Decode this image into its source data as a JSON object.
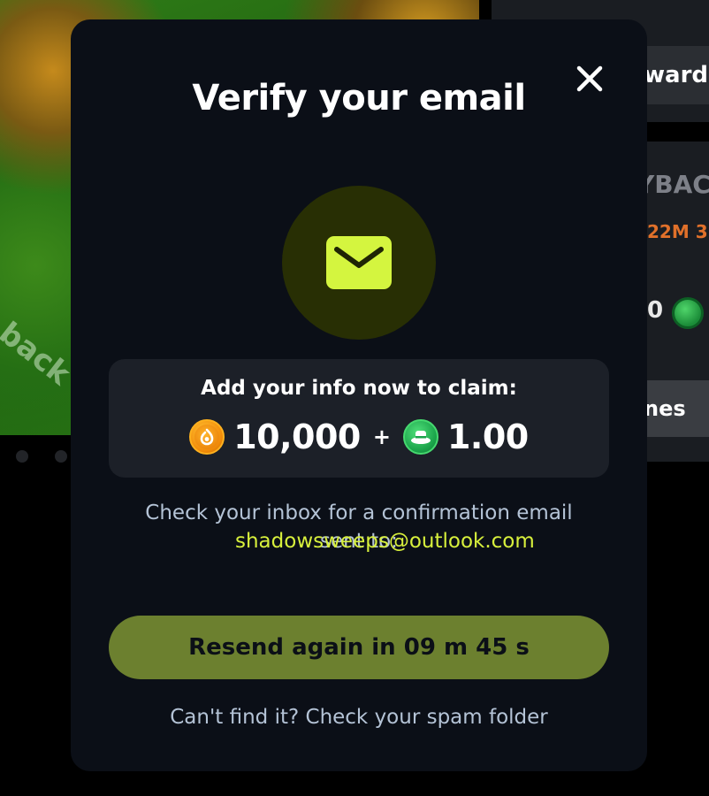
{
  "background": {
    "banner_text": "back",
    "reward_button_label": "ward",
    "payback_title": "YBAC",
    "payback_timer": "22M 3",
    "payback_amount": "0",
    "games_button_label": "nes"
  },
  "modal": {
    "title": "Verify your email",
    "close_icon": "close-icon",
    "mail_icon": "envelope-icon",
    "claim_heading": "Add your info now to claim:",
    "claim": {
      "gold_amount": "10,000",
      "plus": "+",
      "green_amount": "1.00"
    },
    "info_text_prefix": "Check your inbox for a confirmation email sent to:",
    "email": "shadowsweeps@outlook.com",
    "resend_button_label": "Resend again in 09 m 45 s",
    "spam_hint": "Can't find it? Check your spam folder"
  },
  "colors": {
    "accent": "#d4f53f",
    "modal_bg": "#0b0f17",
    "button_bg": "#6c802f",
    "muted_text": "#b4c3d6"
  }
}
